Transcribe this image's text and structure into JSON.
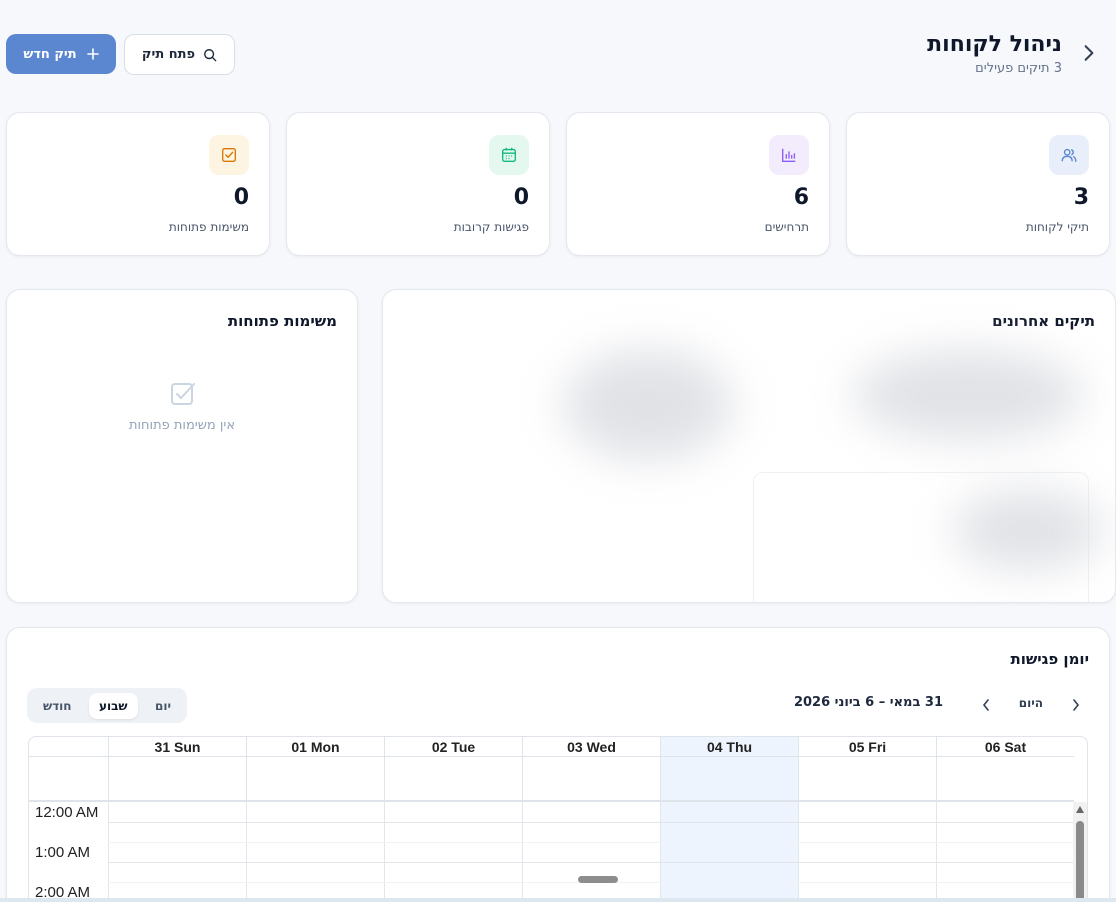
{
  "header": {
    "title": "ניהול לקוחות",
    "subtitle": "3 תיקים פעילים",
    "new_button": "תיק חדש",
    "open_button": "פתח תיק"
  },
  "stats": [
    {
      "label": "תיקי לקוחות",
      "value": "3",
      "icon": "users-icon",
      "accent": "#5b87d0"
    },
    {
      "label": "תרחישים",
      "value": "6",
      "icon": "bar-chart-icon",
      "accent": "#8b5cf6"
    },
    {
      "label": "פגישות קרובות",
      "value": "0",
      "icon": "calendar-icon",
      "accent": "#10b981"
    },
    {
      "label": "משימות פתוחות",
      "value": "0",
      "icon": "checkbox-icon",
      "accent": "#d97706"
    }
  ],
  "recent": {
    "title": "תיקים אחרונים"
  },
  "tasks": {
    "title": "משימות פתוחות",
    "empty": "אין משימות פתוחות"
  },
  "calendar": {
    "title": "יומן פגישות",
    "today": "היום",
    "range": "31 במאי – 6 ביוני 2026",
    "views": [
      "יום",
      "שבוע",
      "חודש"
    ],
    "active_view": "שבוע",
    "days": [
      "31 Sun",
      "01 Mon",
      "02 Tue",
      "03 Wed",
      "04 Thu",
      "05 Fri",
      "06 Sat"
    ],
    "highlight_day": "04 Thu",
    "hours": [
      "12:00 AM",
      "1:00 AM",
      "2:00 AM"
    ]
  }
}
